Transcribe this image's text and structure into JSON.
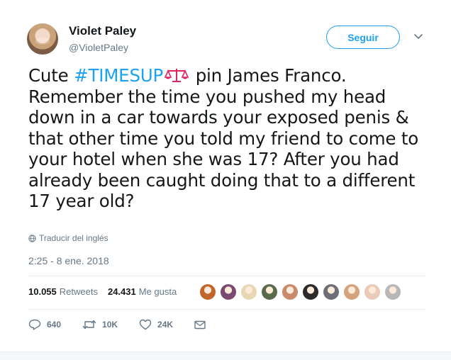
{
  "author": {
    "name": "Violet Paley",
    "handle": "@VioletPaley"
  },
  "follow_button": {
    "label": "Seguir"
  },
  "tweet": {
    "lines": [
      [
        "Cute ",
        "#TIMESUP",
        "pin James Franco."
      ],
      "Remember the time you pushed my head",
      "down in a car towards your exposed penis &",
      "that other time you told my friend to come to",
      "your hotel when she was 17? After you had",
      "already been caught doing that to a different",
      "17 year old?"
    ],
    "line1_prefix": "Cute ",
    "hashtag": "#TIMESUP",
    "line1_suffix": " pin James Franco.",
    "line2": "Remember the time you pushed my head",
    "line3": "down in a car towards your exposed penis &",
    "line4": "that other time you told my friend to come to",
    "line5": "your hotel when she was 17? After you had",
    "line6": "already been caught doing that to a different",
    "line7": "17 year old?",
    "emoji": "scales-icon"
  },
  "translate_label": "Traducir del inglés",
  "timestamp": "2:25 - 8 ene. 2018",
  "stats": {
    "retweets_count": "10.055",
    "retweets_label": "Retweets",
    "likes_count": "24.431",
    "likes_label": "Me gusta"
  },
  "liker_colors": [
    "#c2652a",
    "#7a4a72",
    "#e8d7b5",
    "#5b6a4c",
    "#c98a6a",
    "#2b2b2b",
    "#6b6f78",
    "#d4a27b",
    "#e9c9b8",
    "#b7b7b7"
  ],
  "actions": {
    "replies": "640",
    "retweets": "10K",
    "likes": "24K"
  },
  "colors": {
    "accent": "#1da1f2",
    "text": "#14171a",
    "secondary": "#657786",
    "divider": "#e6ecf0"
  }
}
